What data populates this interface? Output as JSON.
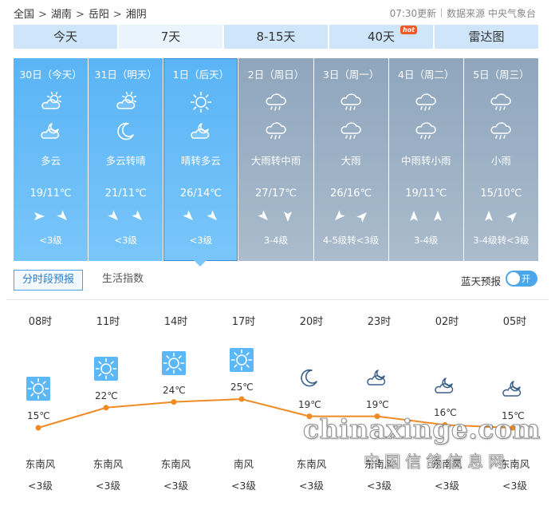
{
  "breadcrumb": [
    "全国",
    "湖南",
    "岳阳",
    "湘阴"
  ],
  "update_time": "07:30更新",
  "source": "数据来源 中央气象台",
  "tabs": [
    {
      "label": "今天"
    },
    {
      "label": "7天",
      "active": true
    },
    {
      "label": "8-15天"
    },
    {
      "label": "40天",
      "badge": "hot"
    },
    {
      "label": "雷达图"
    }
  ],
  "days": [
    {
      "date": "30日（今天）",
      "icon1": "partly-cloudy-day-icon",
      "icon2": "partly-cloudy-night-icon",
      "desc": "多云",
      "temp": "19/11℃",
      "wind1": "east",
      "wind2": "southeast",
      "level": "<3级",
      "style": "sunny"
    },
    {
      "date": "31日（明天）",
      "icon1": "partly-cloudy-day-icon",
      "icon2": "moon-icon",
      "desc": "多云转晴",
      "temp": "21/11℃",
      "wind1": "southeast",
      "wind2": "southeast",
      "level": "<3级",
      "style": "sunny"
    },
    {
      "date": "1日（后天）",
      "icon1": "sun-icon",
      "icon2": "partly-cloudy-night-icon",
      "desc": "晴转多云",
      "temp": "26/14℃",
      "wind1": "southeast",
      "wind2": "southeast",
      "level": "<3级",
      "style": "sunny",
      "selected": true
    },
    {
      "date": "2日（周日）",
      "icon1": "rain-icon",
      "icon2": "rain-icon",
      "desc": "大雨转中雨",
      "temp": "27/17℃",
      "wind1": "southeast",
      "wind2": "south",
      "level": "3-4级",
      "style": "rainy"
    },
    {
      "date": "3日（周一）",
      "icon1": "rain-icon",
      "icon2": "rain-icon",
      "desc": "大雨",
      "temp": "26/16℃",
      "wind1": "southwest",
      "wind2": "northeast",
      "level": "4-5级转<3级",
      "style": "rainy"
    },
    {
      "date": "4日（周二）",
      "icon1": "rain-icon",
      "icon2": "rain-icon",
      "desc": "中雨转小雨",
      "temp": "19/11℃",
      "wind1": "north",
      "wind2": "north",
      "level": "3-4级",
      "style": "rainy"
    },
    {
      "date": "5日（周三）",
      "icon1": "rain-icon",
      "icon2": "rain-icon",
      "desc": "小雨",
      "temp": "15/10℃",
      "wind1": "north",
      "wind2": "northeast",
      "level": "3-4级转<3级",
      "style": "rainy"
    }
  ],
  "subtabs": [
    {
      "label": "分时段预报",
      "active": true
    },
    {
      "label": "生活指数"
    }
  ],
  "lantian": {
    "label": "蓝天预报",
    "toggle": "开"
  },
  "hourly": [
    {
      "time": "08时",
      "icon": "sun-icon",
      "temp": "15℃",
      "value": 15,
      "wind": "东南风",
      "level": "<3级"
    },
    {
      "time": "11时",
      "icon": "sun-icon",
      "temp": "22℃",
      "value": 22,
      "wind": "东南风",
      "level": "<3级"
    },
    {
      "time": "14时",
      "icon": "sun-icon",
      "temp": "24℃",
      "value": 24,
      "wind": "东南风",
      "level": "<3级"
    },
    {
      "time": "17时",
      "icon": "sun-icon",
      "temp": "25℃",
      "value": 25,
      "wind": "南风",
      "level": "<3级"
    },
    {
      "time": "20时",
      "icon": "moon-icon",
      "temp": "19℃",
      "value": 19,
      "wind": "东南风",
      "level": "<3级"
    },
    {
      "time": "23时",
      "icon": "partly-cloudy-night-icon",
      "temp": "19℃",
      "value": 19,
      "wind": "东南风",
      "level": "<3级"
    },
    {
      "time": "02时",
      "icon": "partly-cloudy-night-icon",
      "temp": "16℃",
      "value": 16,
      "wind": "东南风",
      "level": "<3级"
    },
    {
      "time": "05时",
      "icon": "partly-cloudy-night-icon",
      "temp": "15℃",
      "value": 15,
      "wind": "东南风",
      "level": "<3级"
    }
  ],
  "watermark": {
    "main": "chinaxinge.com",
    "sub": "中国信鸽信息网"
  },
  "colors": {
    "sunny": "#5ab4f5",
    "rainy": "#8fa6bd",
    "line": "#f08a24",
    "accent": "#4ba7ea"
  }
}
